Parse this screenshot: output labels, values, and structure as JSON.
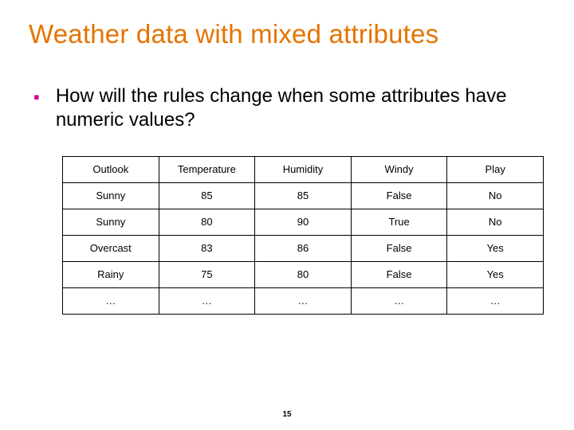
{
  "title": "Weather data with mixed attributes",
  "bullet_text": "How will the rules change when some attributes have numeric values?",
  "table": {
    "headers": [
      "Outlook",
      "Temperature",
      "Humidity",
      "Windy",
      "Play"
    ],
    "rows": [
      [
        "Sunny",
        "85",
        "85",
        "False",
        "No"
      ],
      [
        "Sunny",
        "80",
        "90",
        "True",
        "No"
      ],
      [
        "Overcast",
        "83",
        "86",
        "False",
        "Yes"
      ],
      [
        "Rainy",
        "75",
        "80",
        "False",
        "Yes"
      ],
      [
        "…",
        "…",
        "…",
        "…",
        "…"
      ]
    ]
  },
  "page_number": "15",
  "chart_data": {
    "type": "table",
    "title": "Weather data with mixed attributes",
    "headers": [
      "Outlook",
      "Temperature",
      "Humidity",
      "Windy",
      "Play"
    ],
    "rows": [
      {
        "Outlook": "Sunny",
        "Temperature": 85,
        "Humidity": 85,
        "Windy": "False",
        "Play": "No"
      },
      {
        "Outlook": "Sunny",
        "Temperature": 80,
        "Humidity": 90,
        "Windy": "True",
        "Play": "No"
      },
      {
        "Outlook": "Overcast",
        "Temperature": 83,
        "Humidity": 86,
        "Windy": "False",
        "Play": "Yes"
      },
      {
        "Outlook": "Rainy",
        "Temperature": 75,
        "Humidity": 80,
        "Windy": "False",
        "Play": "Yes"
      }
    ]
  }
}
